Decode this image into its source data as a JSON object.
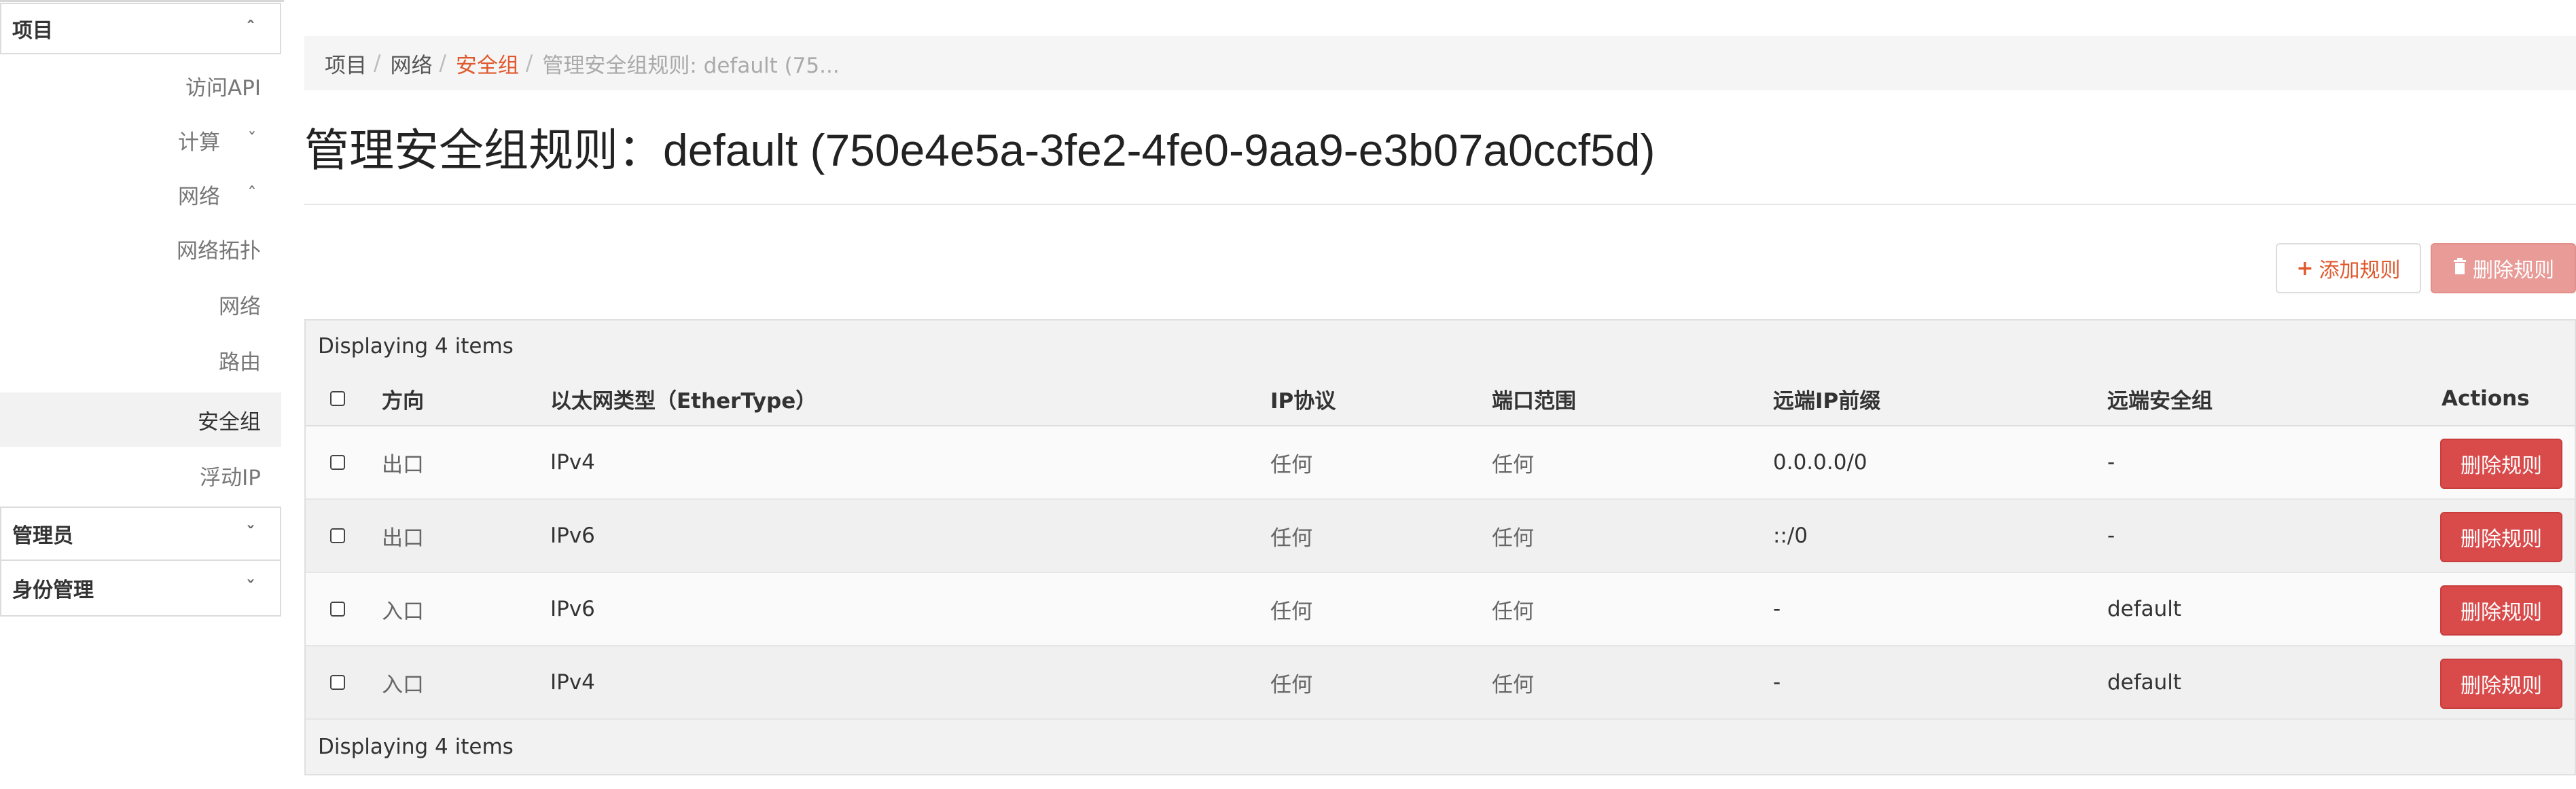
{
  "sidebar": {
    "project_label": "项目",
    "items": {
      "access_api": "访问API",
      "compute": "计算",
      "network": "网络",
      "network_topology": "网络拓扑",
      "networks": "网络",
      "routers": "路由",
      "security_groups": "安全组",
      "floating_ip": "浮动IP"
    },
    "admin_label": "管理员",
    "identity_label": "身份管理",
    "chevrons": {
      "up": "ˆ",
      "down": "ˇ"
    }
  },
  "breadcrumb": {
    "items": [
      "项目",
      "网络",
      "安全组",
      "管理安全组规则: default (75..."
    ],
    "sep": "/"
  },
  "page": {
    "title": "管理安全组规则：default (750e4e5a-3fe2-4fe0-9aa9-e3b07a0ccf5d)"
  },
  "toolbar": {
    "add_rule": "添加规则",
    "delete_rules": "删除规则",
    "add_icon": "plus-icon",
    "delete_icon": "trash-icon"
  },
  "table": {
    "caption": "Displaying 4 items",
    "footer": "Displaying 4 items",
    "headers": {
      "direction": "方向",
      "ethertype": "以太网类型（EtherType）",
      "ip_protocol": "IP协议",
      "port_range": "端口范围",
      "remote_ip_prefix": "远端IP前缀",
      "remote_group": "远端安全组",
      "actions": "Actions"
    },
    "rows": [
      {
        "direction": "出口",
        "ethertype": "IPv4",
        "ip_protocol": "任何",
        "port_range": "任何",
        "remote_ip_prefix": "0.0.0.0/0",
        "remote_group": "-",
        "action": "删除规则"
      },
      {
        "direction": "出口",
        "ethertype": "IPv6",
        "ip_protocol": "任何",
        "port_range": "任何",
        "remote_ip_prefix": "::/0",
        "remote_group": "-",
        "action": "删除规则"
      },
      {
        "direction": "入口",
        "ethertype": "IPv6",
        "ip_protocol": "任何",
        "port_range": "任何",
        "remote_ip_prefix": "-",
        "remote_group": "default",
        "action": "删除规则"
      },
      {
        "direction": "入口",
        "ethertype": "IPv4",
        "ip_protocol": "任何",
        "port_range": "任何",
        "remote_ip_prefix": "-",
        "remote_group": "default",
        "action": "删除规则"
      }
    ]
  },
  "colors": {
    "accent": "#e0582d",
    "danger": "#d94b4b",
    "danger_disabled": "#e89b97"
  }
}
